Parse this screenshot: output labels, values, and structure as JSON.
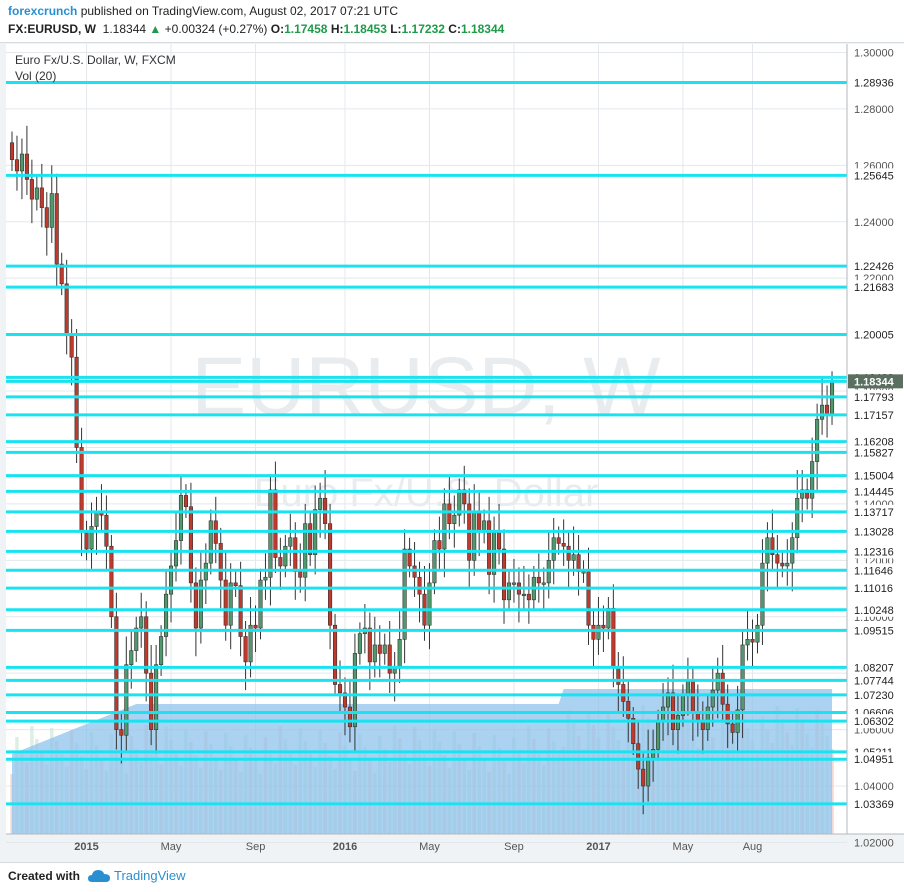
{
  "header": {
    "brand": "forexcrunch",
    "published": "published on TradingView.com, August 02, 2017 07:21 UTC",
    "symbol": "FX:EURUSD, W",
    "last": "1.18344",
    "change": "+0.00324 (+0.27%)",
    "o_label": "O:",
    "o": "1.17458",
    "h_label": "H:",
    "h": "1.18453",
    "l_label": "L:",
    "l": "1.17232",
    "c_label": "C:",
    "c": "1.18344"
  },
  "footer": {
    "created": "Created with",
    "tv": "TradingView"
  },
  "colors": {
    "up": "#4f9a6d",
    "down": "#c0392b",
    "level": "#19e3f0",
    "volume": "#8fc3ec",
    "grid": "#e4e8ec"
  },
  "chart_data": {
    "type": "candlestick",
    "title": "Euro Fx/U.S. Dollar, W, FXCM",
    "subtitle": "Vol (20)",
    "watermark_symbol": "EURUSD, W",
    "watermark_name": "Euro Fx/U.S. Dollar",
    "ylim": [
      1.023,
      1.303
    ],
    "y_ticks": [
      "1.30000",
      "1.28000",
      "1.26000",
      "1.24000",
      "1.22000",
      "1.20000",
      "1.18000",
      "1.16000",
      "1.14000",
      "1.12000",
      "1.10000",
      "1.08000",
      "1.06000",
      "1.04000",
      "1.02000"
    ],
    "x_ticks": [
      "2015",
      "May",
      "Sep",
      "2016",
      "May",
      "Sep",
      "2017",
      "May",
      "Aug"
    ],
    "levels": [
      "1.28936",
      "1.25645",
      "1.22426",
      "1.21683",
      "1.20005",
      "1.18482",
      "1.18344",
      "1.17793",
      "1.17157",
      "1.16208",
      "1.15827",
      "1.15004",
      "1.14445",
      "1.13717",
      "1.13028",
      "1.12316",
      "1.11646",
      "1.11016",
      "1.10248",
      "1.09515",
      "1.08207",
      "1.07744",
      "1.07230",
      "1.06606",
      "1.06302",
      "1.05211",
      "1.04951",
      "1.03369"
    ],
    "current_price": "1.18344",
    "close": [
      1.262,
      1.258,
      1.264,
      1.255,
      1.248,
      1.252,
      1.245,
      1.238,
      1.25,
      1.225,
      1.218,
      1.2,
      1.192,
      1.16,
      1.13,
      1.124,
      1.132,
      1.137,
      1.136,
      1.125,
      1.1,
      1.06,
      1.058,
      1.083,
      1.088,
      1.096,
      1.1,
      1.08,
      1.06,
      1.083,
      1.093,
      1.108,
      1.118,
      1.127,
      1.143,
      1.139,
      1.112,
      1.096,
      1.113,
      1.119,
      1.134,
      1.126,
      1.113,
      1.097,
      1.112,
      1.111,
      1.093,
      1.084,
      1.097,
      1.096,
      1.113,
      1.114,
      1.145,
      1.121,
      1.118,
      1.125,
      1.128,
      1.116,
      1.114,
      1.133,
      1.122,
      1.138,
      1.142,
      1.133,
      1.097,
      1.076,
      1.073,
      1.068,
      1.061,
      1.087,
      1.094,
      1.096,
      1.084,
      1.09,
      1.087,
      1.09,
      1.08,
      1.082,
      1.092,
      1.124,
      1.118,
      1.114,
      1.108,
      1.097,
      1.112,
      1.127,
      1.124,
      1.14,
      1.133,
      1.136,
      1.145,
      1.14,
      1.12,
      1.137,
      1.13,
      1.134,
      1.115,
      1.13,
      1.124,
      1.106,
      1.112,
      1.112,
      1.108,
      1.108,
      1.106,
      1.114,
      1.112,
      1.112,
      1.12,
      1.128,
      1.126,
      1.125,
      1.12,
      1.122,
      1.116,
      1.116,
      1.097,
      1.092,
      1.097,
      1.096,
      1.103,
      1.082,
      1.076,
      1.07,
      1.064,
      1.055,
      1.046,
      1.04,
      1.05,
      1.053,
      1.063,
      1.068,
      1.073,
      1.06,
      1.065,
      1.072,
      1.077,
      1.066,
      1.063,
      1.06,
      1.068,
      1.074,
      1.08,
      1.069,
      1.062,
      1.059,
      1.067,
      1.09,
      1.092,
      1.091,
      1.097,
      1.119,
      1.128,
      1.122,
      1.119,
      1.118,
      1.119,
      1.128,
      1.142,
      1.145,
      1.142,
      1.155,
      1.17,
      1.175,
      1.172,
      1.183
    ]
  }
}
